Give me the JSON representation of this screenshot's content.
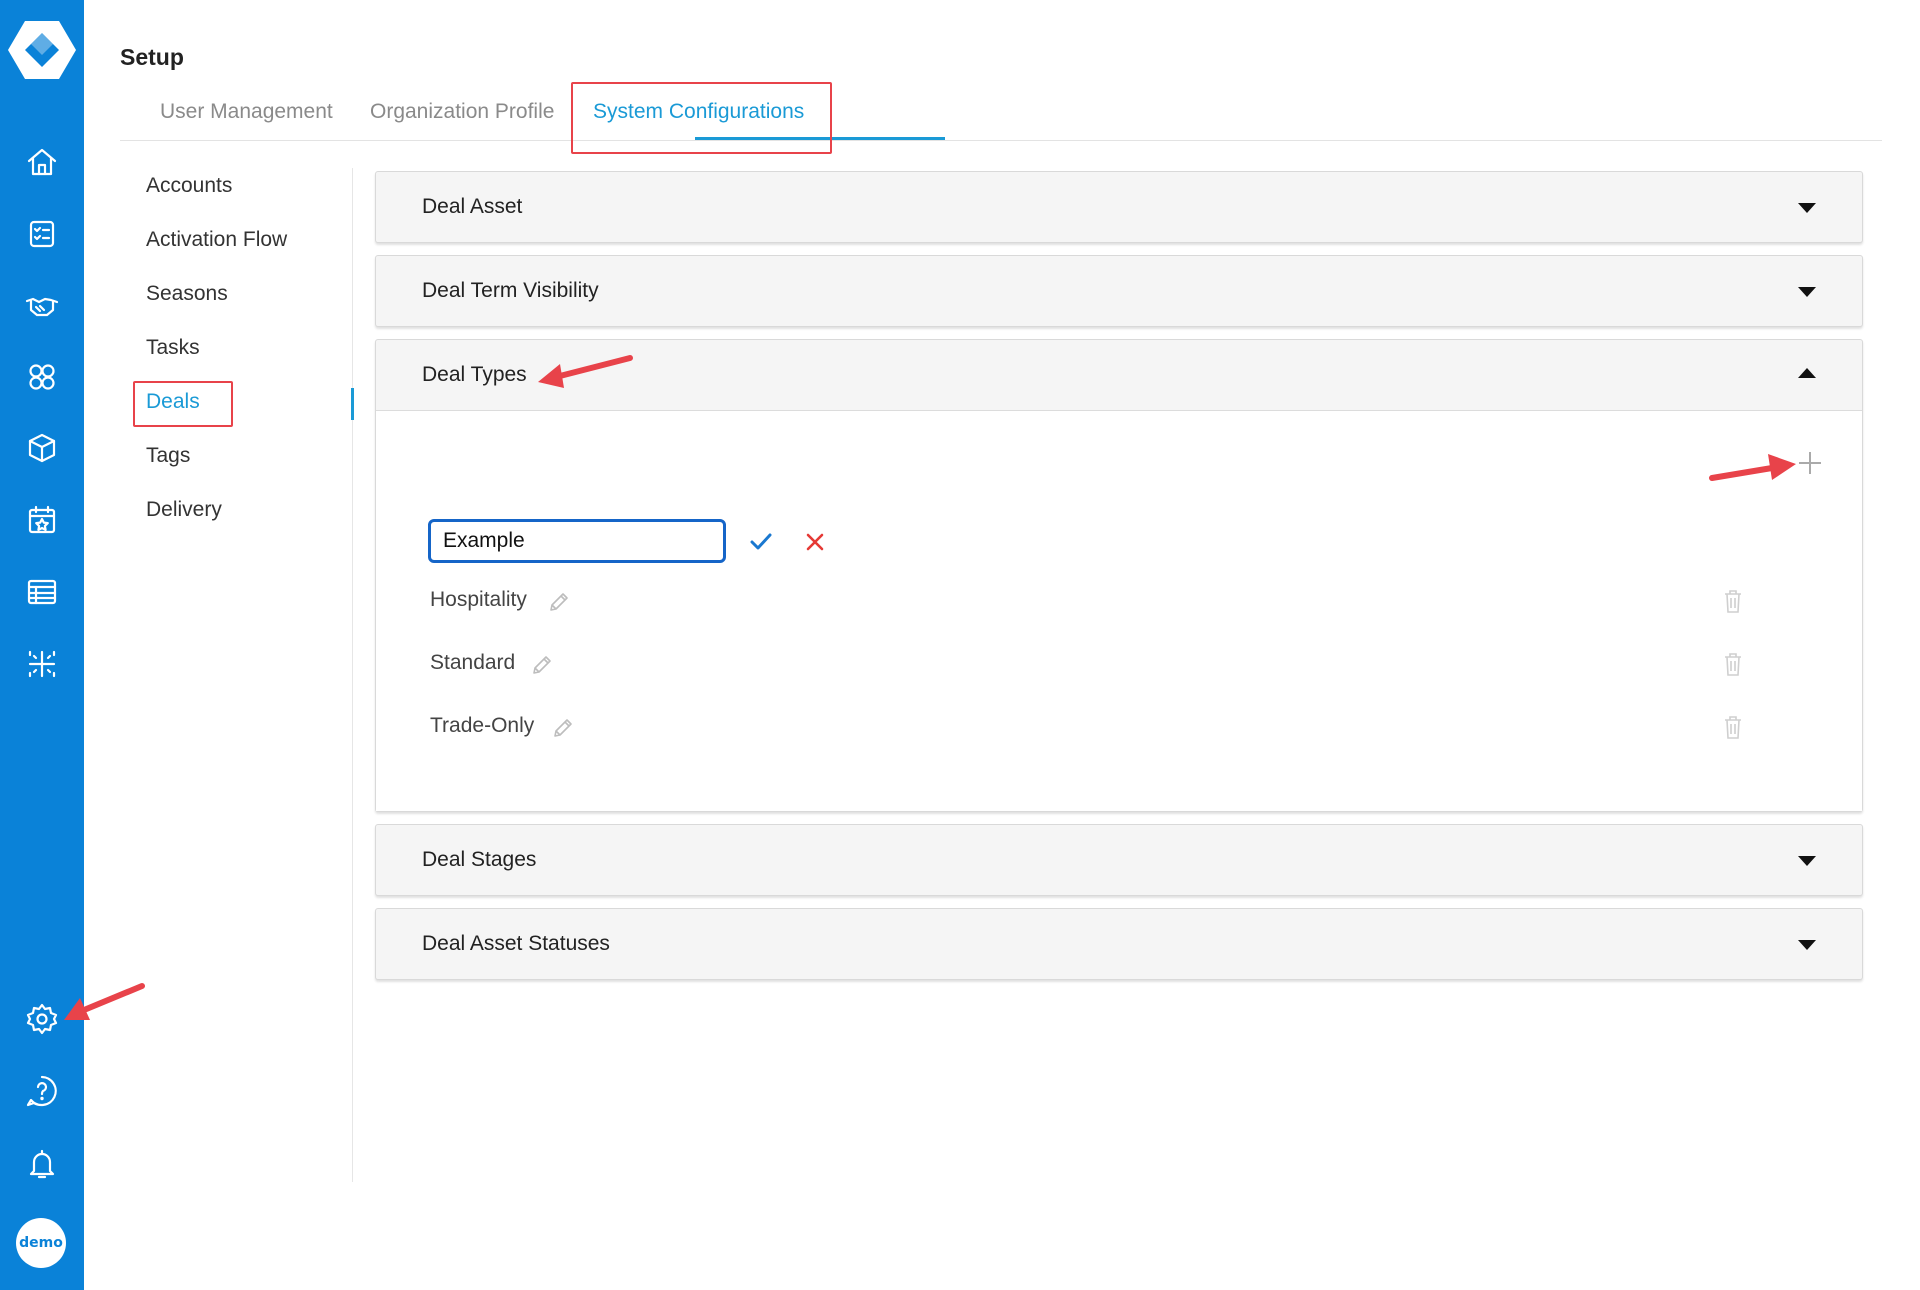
{
  "page": {
    "title": "Setup"
  },
  "tabs": [
    {
      "label": "User Management"
    },
    {
      "label": "Organization Profile"
    },
    {
      "label": "System Configurations",
      "active": true
    }
  ],
  "subnav": [
    {
      "label": "Accounts"
    },
    {
      "label": "Activation Flow"
    },
    {
      "label": "Seasons"
    },
    {
      "label": "Tasks"
    },
    {
      "label": "Deals",
      "active": true
    },
    {
      "label": "Tags"
    },
    {
      "label": "Delivery"
    }
  ],
  "rail": {
    "icons": [
      "home-icon",
      "checklist-icon",
      "handshake-icon",
      "group-icon",
      "package-icon",
      "calendar-star-icon",
      "table-icon",
      "sparkle-icon"
    ],
    "bottom_icons": [
      "gear-icon",
      "help-icon",
      "bell-icon"
    ],
    "avatar_label": "demo"
  },
  "panels": [
    {
      "title": "Deal Asset",
      "expanded": false
    },
    {
      "title": "Deal Term Visibility",
      "expanded": false
    },
    {
      "title": "Deal Types",
      "expanded": true
    },
    {
      "title": "Deal Stages",
      "expanded": false
    },
    {
      "title": "Deal Asset Statuses",
      "expanded": false
    }
  ],
  "deal_types": {
    "new_input_value": "Example",
    "items": [
      "Hospitality",
      "Standard",
      "Trade-Only"
    ]
  },
  "colors": {
    "rail": "#0a82d8",
    "accent": "#1a9ad6",
    "annotation": "#e8434a",
    "cancel": "#e53935"
  }
}
